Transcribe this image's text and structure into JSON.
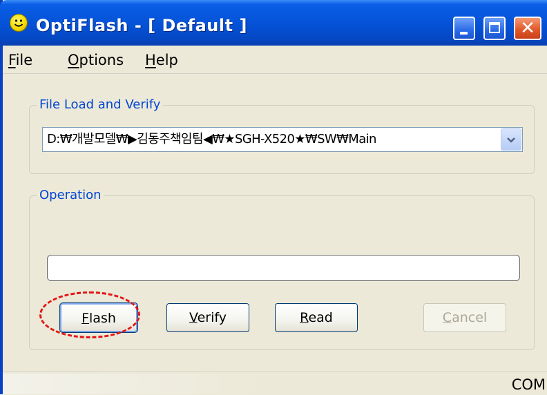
{
  "window": {
    "title": "OptiFlash - [ Default ]",
    "icon": "smiley-icon",
    "controls": [
      "minimize-icon",
      "maximize-icon",
      "close-icon"
    ]
  },
  "menu": {
    "items": [
      {
        "label": "File",
        "hotkey": "F"
      },
      {
        "label": "Options",
        "hotkey": "O"
      },
      {
        "label": "Help",
        "hotkey": "H"
      }
    ]
  },
  "file_group": {
    "label": "File Load and Verify",
    "combo_value": "D:₩개발모델₩▶김동주책임팀◀₩★SGH-X520★₩SW₩Main"
  },
  "operation_group": {
    "label": "Operation",
    "progress_value": 0,
    "buttons": {
      "flash": {
        "label": "Flash",
        "hotkey": "F"
      },
      "verify": {
        "label": "Verify",
        "hotkey": "V"
      },
      "read": {
        "label": "Read",
        "hotkey": "R"
      },
      "cancel": {
        "label": "Cancel",
        "hotkey": "C",
        "enabled": false
      }
    }
  },
  "statusbar": {
    "text": "COM"
  },
  "colors": {
    "title_bar": "#0553d8",
    "group_label": "#0046d5",
    "annotation": "#e41414"
  }
}
